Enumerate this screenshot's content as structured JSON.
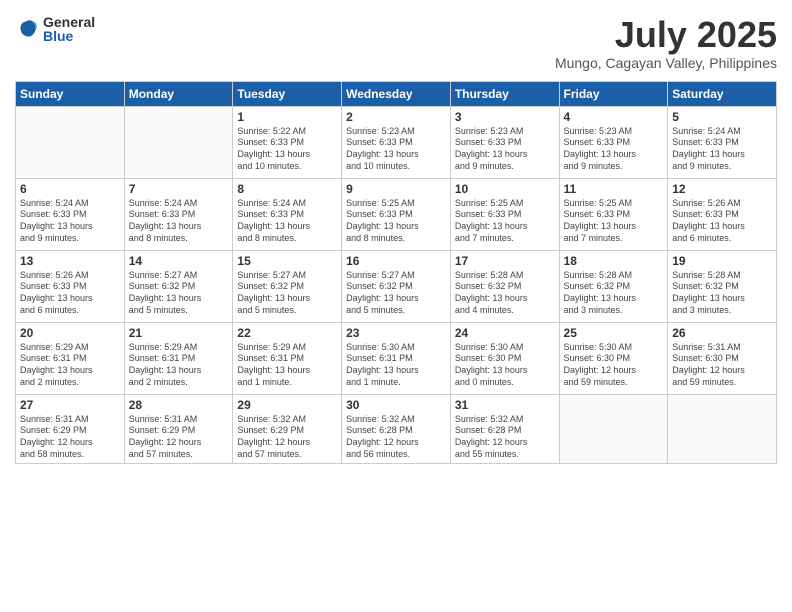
{
  "logo": {
    "general": "General",
    "blue": "Blue"
  },
  "title": "July 2025",
  "location": "Mungo, Cagayan Valley, Philippines",
  "weekdays": [
    "Sunday",
    "Monday",
    "Tuesday",
    "Wednesday",
    "Thursday",
    "Friday",
    "Saturday"
  ],
  "weeks": [
    [
      {
        "day": "",
        "info": ""
      },
      {
        "day": "",
        "info": ""
      },
      {
        "day": "1",
        "info": "Sunrise: 5:22 AM\nSunset: 6:33 PM\nDaylight: 13 hours\nand 10 minutes."
      },
      {
        "day": "2",
        "info": "Sunrise: 5:23 AM\nSunset: 6:33 PM\nDaylight: 13 hours\nand 10 minutes."
      },
      {
        "day": "3",
        "info": "Sunrise: 5:23 AM\nSunset: 6:33 PM\nDaylight: 13 hours\nand 9 minutes."
      },
      {
        "day": "4",
        "info": "Sunrise: 5:23 AM\nSunset: 6:33 PM\nDaylight: 13 hours\nand 9 minutes."
      },
      {
        "day": "5",
        "info": "Sunrise: 5:24 AM\nSunset: 6:33 PM\nDaylight: 13 hours\nand 9 minutes."
      }
    ],
    [
      {
        "day": "6",
        "info": "Sunrise: 5:24 AM\nSunset: 6:33 PM\nDaylight: 13 hours\nand 9 minutes."
      },
      {
        "day": "7",
        "info": "Sunrise: 5:24 AM\nSunset: 6:33 PM\nDaylight: 13 hours\nand 8 minutes."
      },
      {
        "day": "8",
        "info": "Sunrise: 5:24 AM\nSunset: 6:33 PM\nDaylight: 13 hours\nand 8 minutes."
      },
      {
        "day": "9",
        "info": "Sunrise: 5:25 AM\nSunset: 6:33 PM\nDaylight: 13 hours\nand 8 minutes."
      },
      {
        "day": "10",
        "info": "Sunrise: 5:25 AM\nSunset: 6:33 PM\nDaylight: 13 hours\nand 7 minutes."
      },
      {
        "day": "11",
        "info": "Sunrise: 5:25 AM\nSunset: 6:33 PM\nDaylight: 13 hours\nand 7 minutes."
      },
      {
        "day": "12",
        "info": "Sunrise: 5:26 AM\nSunset: 6:33 PM\nDaylight: 13 hours\nand 6 minutes."
      }
    ],
    [
      {
        "day": "13",
        "info": "Sunrise: 5:26 AM\nSunset: 6:33 PM\nDaylight: 13 hours\nand 6 minutes."
      },
      {
        "day": "14",
        "info": "Sunrise: 5:27 AM\nSunset: 6:32 PM\nDaylight: 13 hours\nand 5 minutes."
      },
      {
        "day": "15",
        "info": "Sunrise: 5:27 AM\nSunset: 6:32 PM\nDaylight: 13 hours\nand 5 minutes."
      },
      {
        "day": "16",
        "info": "Sunrise: 5:27 AM\nSunset: 6:32 PM\nDaylight: 13 hours\nand 5 minutes."
      },
      {
        "day": "17",
        "info": "Sunrise: 5:28 AM\nSunset: 6:32 PM\nDaylight: 13 hours\nand 4 minutes."
      },
      {
        "day": "18",
        "info": "Sunrise: 5:28 AM\nSunset: 6:32 PM\nDaylight: 13 hours\nand 3 minutes."
      },
      {
        "day": "19",
        "info": "Sunrise: 5:28 AM\nSunset: 6:32 PM\nDaylight: 13 hours\nand 3 minutes."
      }
    ],
    [
      {
        "day": "20",
        "info": "Sunrise: 5:29 AM\nSunset: 6:31 PM\nDaylight: 13 hours\nand 2 minutes."
      },
      {
        "day": "21",
        "info": "Sunrise: 5:29 AM\nSunset: 6:31 PM\nDaylight: 13 hours\nand 2 minutes."
      },
      {
        "day": "22",
        "info": "Sunrise: 5:29 AM\nSunset: 6:31 PM\nDaylight: 13 hours\nand 1 minute."
      },
      {
        "day": "23",
        "info": "Sunrise: 5:30 AM\nSunset: 6:31 PM\nDaylight: 13 hours\nand 1 minute."
      },
      {
        "day": "24",
        "info": "Sunrise: 5:30 AM\nSunset: 6:30 PM\nDaylight: 13 hours\nand 0 minutes."
      },
      {
        "day": "25",
        "info": "Sunrise: 5:30 AM\nSunset: 6:30 PM\nDaylight: 12 hours\nand 59 minutes."
      },
      {
        "day": "26",
        "info": "Sunrise: 5:31 AM\nSunset: 6:30 PM\nDaylight: 12 hours\nand 59 minutes."
      }
    ],
    [
      {
        "day": "27",
        "info": "Sunrise: 5:31 AM\nSunset: 6:29 PM\nDaylight: 12 hours\nand 58 minutes."
      },
      {
        "day": "28",
        "info": "Sunrise: 5:31 AM\nSunset: 6:29 PM\nDaylight: 12 hours\nand 57 minutes."
      },
      {
        "day": "29",
        "info": "Sunrise: 5:32 AM\nSunset: 6:29 PM\nDaylight: 12 hours\nand 57 minutes."
      },
      {
        "day": "30",
        "info": "Sunrise: 5:32 AM\nSunset: 6:28 PM\nDaylight: 12 hours\nand 56 minutes."
      },
      {
        "day": "31",
        "info": "Sunrise: 5:32 AM\nSunset: 6:28 PM\nDaylight: 12 hours\nand 55 minutes."
      },
      {
        "day": "",
        "info": ""
      },
      {
        "day": "",
        "info": ""
      }
    ]
  ]
}
